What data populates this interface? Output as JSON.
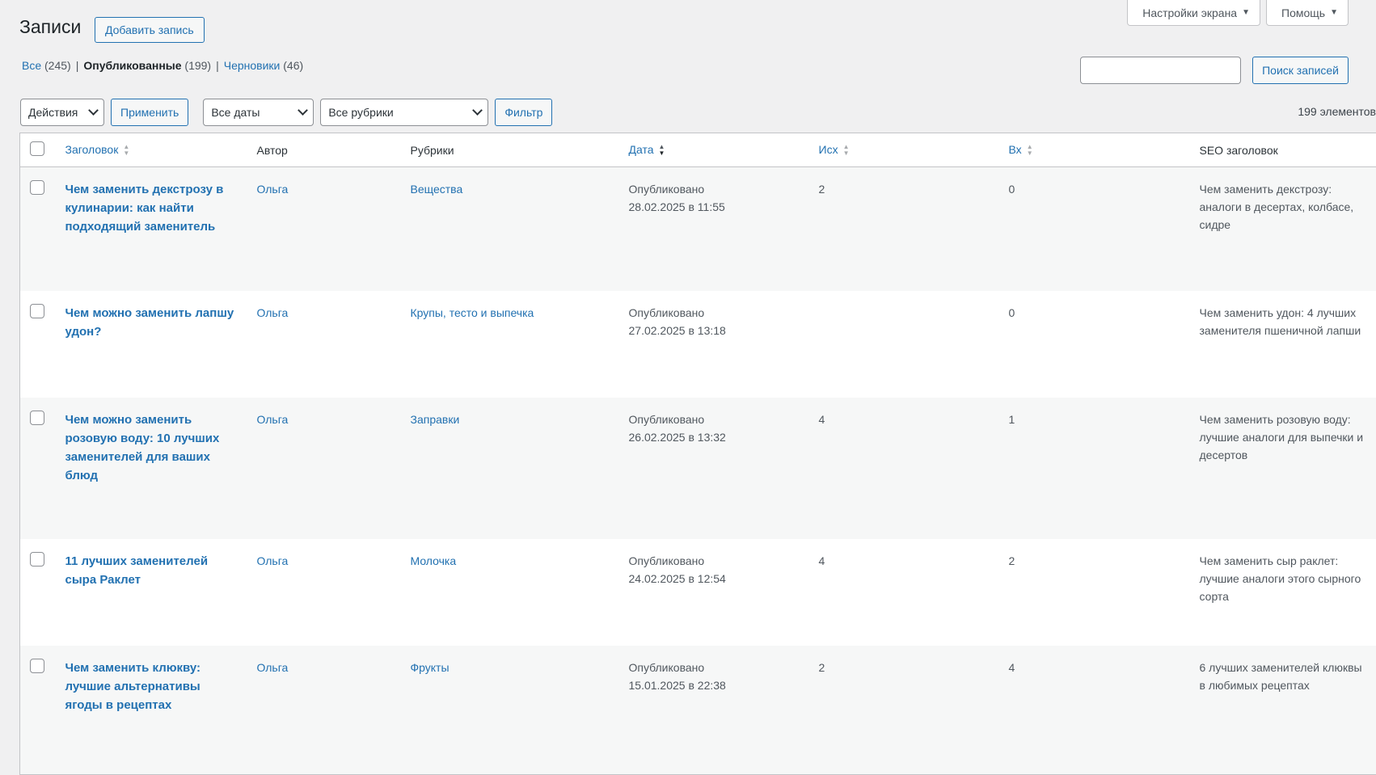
{
  "screen_tabs": {
    "screen_options": "Настройки экрана",
    "help": "Помощь"
  },
  "page_title": "Записи",
  "add_new": "Добавить запись",
  "views": {
    "all_label": "Все",
    "all_count": "(245)",
    "published_label": "Опубликованные",
    "published_count": "(199)",
    "drafts_label": "Черновики",
    "drafts_count": "(46)"
  },
  "search": {
    "button": "Поиск записей",
    "value": ""
  },
  "tablenav": {
    "bulk_actions": "Действия",
    "apply": "Применить",
    "dates": "Все даты",
    "categories": "Все рубрики",
    "filter": "Фильтр",
    "items_count": "199 элементов"
  },
  "columns": {
    "title": "Заголовок",
    "author": "Автор",
    "categories": "Рубрики",
    "date": "Дата",
    "outgoing": "Исх",
    "incoming": "Вх",
    "seo_title": "SEO заголовок"
  },
  "rows": [
    {
      "title": "Чем заменить декстрозу в кулинарии: как найти подходящий заменитель",
      "author": "Ольга",
      "category": "Вещества",
      "status": "Опубликовано",
      "date": "28.02.2025 в 11:55",
      "out": "2",
      "in": "0",
      "seo": "Чем заменить декстрозу: аналоги в десертах, колбасе, сидре"
    },
    {
      "title": "Чем можно заменить лапшу удон?",
      "author": "Ольга",
      "category": "Крупы, тесто и выпечка",
      "status": "Опубликовано",
      "date": "27.02.2025 в 13:18",
      "out": "",
      "in": "0",
      "seo": "Чем заменить удон: 4 лучших заменителя пшеничной лапши"
    },
    {
      "title": "Чем можно заменить розовую воду: 10 лучших заменителей для ваших блюд",
      "author": "Ольга",
      "category": "Заправки",
      "status": "Опубликовано",
      "date": "26.02.2025 в 13:32",
      "out": "4",
      "in": "1",
      "seo": "Чем заменить розовую воду: лучшие аналоги для выпечки и десертов"
    },
    {
      "title": "11 лучших заменителей сыра Раклет",
      "author": "Ольга",
      "category": "Молочка",
      "status": "Опубликовано",
      "date": "24.02.2025 в 12:54",
      "out": "4",
      "in": "2",
      "seo": "Чем заменить сыр раклет: лучшие аналоги этого сырного сорта"
    },
    {
      "title": "Чем заменить клюкву: лучшие альтернативы ягоды в рецептах",
      "author": "Ольга",
      "category": "Фрукты",
      "status": "Опубликовано",
      "date": "15.01.2025 в 22:38",
      "out": "2",
      "in": "4",
      "seo": "6 лучших заменителей клюквы в любимых рецептах"
    }
  ]
}
